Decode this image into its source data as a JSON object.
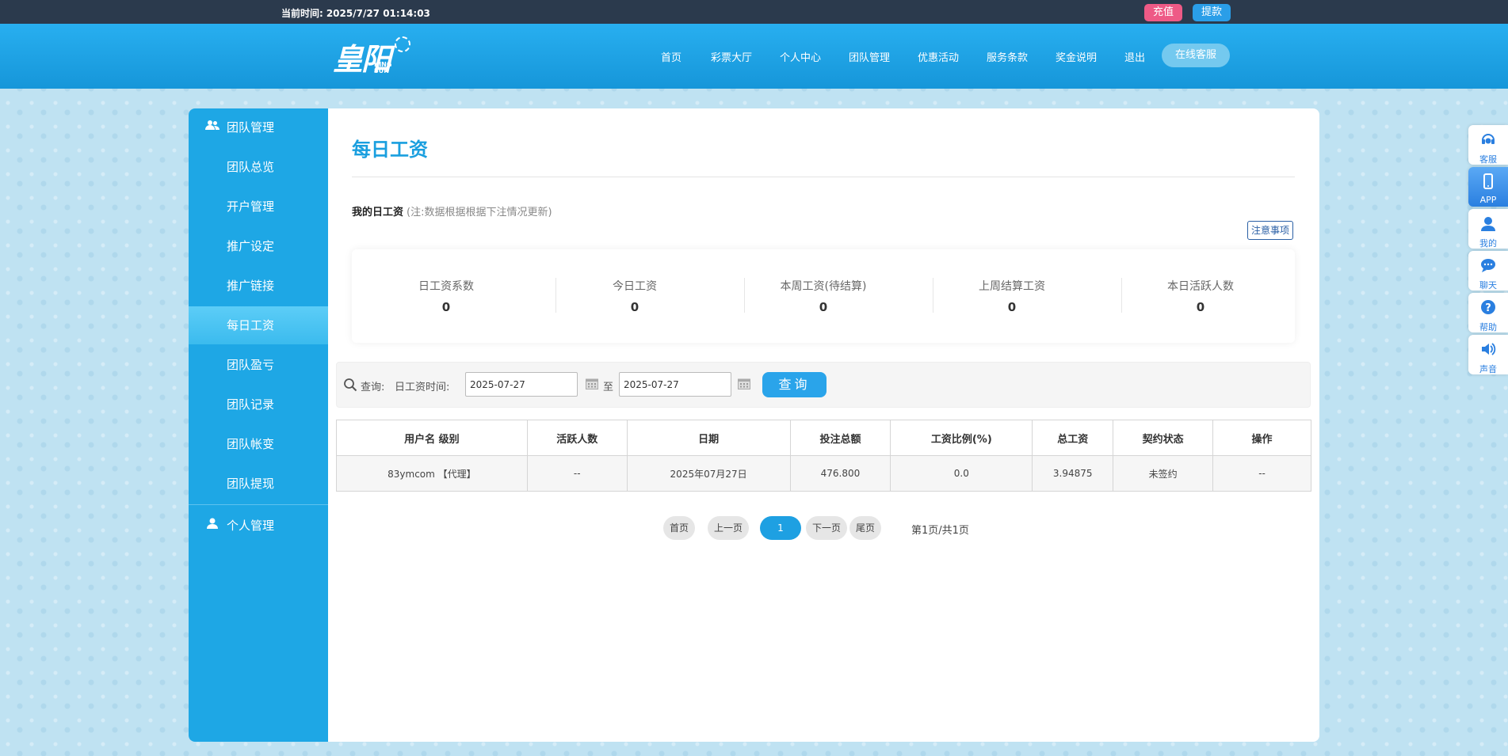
{
  "topbar": {
    "time_label": "当前时间:",
    "time_value": "2025/7/27 01:14:03",
    "recharge": "充值",
    "withdraw": "提款"
  },
  "header": {
    "logo_main": "皇阳",
    "logo_sub_line1": "KING",
    "logo_sub_line2": "SUN",
    "nav": [
      "首页",
      "彩票大厅",
      "个人中心",
      "团队管理",
      "优惠活动",
      "服务条款",
      "奖金说明",
      "退出"
    ],
    "customer_service": "在线客服"
  },
  "sidebar": {
    "team_group": "团队管理",
    "items": [
      "团队总览",
      "开户管理",
      "推广设定",
      "推广链接",
      "每日工资",
      "团队盈亏",
      "团队记录",
      "团队帐变",
      "团队提现"
    ],
    "active_item": "每日工资",
    "personal_group": "个人管理"
  },
  "main": {
    "title": "每日工资",
    "subtitle": "我的日工资",
    "subtitle_note": "(注:数据根据根据下注情况更新)",
    "notice_button": "注意事项",
    "stats": [
      {
        "label": "日工资系数",
        "value": "0"
      },
      {
        "label": "今日工资",
        "value": "0"
      },
      {
        "label": "本周工资(待结算)",
        "value": "0"
      },
      {
        "label": "上周结算工资",
        "value": "0"
      },
      {
        "label": "本日活跃人数",
        "value": "0"
      }
    ],
    "search": {
      "label": "查询:",
      "date_label": "日工资时间:",
      "start_date": "2025-07-27",
      "to_label": "至",
      "end_date": "2025-07-27",
      "query_button": "查询"
    },
    "table": {
      "headers": [
        "用户名  级别",
        "活跃人数",
        "日期",
        "投注总额",
        "工资比例(%)",
        "总工资",
        "契约状态",
        "操作"
      ],
      "rows": [
        [
          "83ymcom 【代理】",
          "--",
          "2025年07月27日",
          "476.800",
          "0.0",
          "3.94875",
          "未签约",
          "--"
        ]
      ]
    },
    "pager": {
      "first": "首页",
      "prev": "上一页",
      "current": "1",
      "next": "下一页",
      "last": "尾页",
      "info": "第1页/共1页"
    }
  },
  "floatbar": {
    "items": [
      "客服",
      "APP",
      "我的",
      "聊天",
      "帮助",
      "声音"
    ]
  },
  "colors": {
    "primary": "#1ea7e5",
    "topbar": "#2b3a4d",
    "recharge": "#ee5a86",
    "title": "#1a9fdf"
  }
}
